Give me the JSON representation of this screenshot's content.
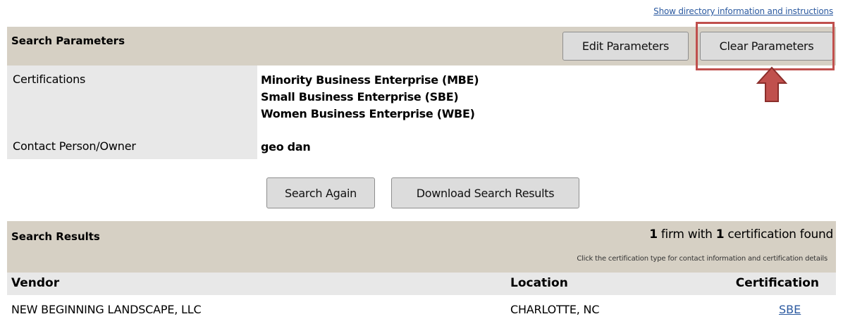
{
  "top_link": "Show directory information and instructions",
  "search_parameters": {
    "title": "Search Parameters",
    "edit_button": "Edit Parameters",
    "clear_button": "Clear Parameters",
    "rows": [
      {
        "label": "Certifications",
        "values": [
          "Minority Business Enterprise (MBE)",
          "Small Business Enterprise (SBE)",
          "Women Business Enterprise (WBE)"
        ]
      },
      {
        "label": "Contact Person/Owner",
        "values": [
          "geo dan"
        ]
      }
    ]
  },
  "actions": {
    "search_again": "Search Again",
    "download": "Download Search Results"
  },
  "search_results": {
    "title": "Search Results",
    "summary": {
      "firm_count": "1",
      "firm_text": " firm with ",
      "cert_count": "1",
      "cert_text": " certification found"
    },
    "note": "Click the certification type for contact information and certification details",
    "columns": {
      "vendor": "Vendor",
      "location": "Location",
      "certification": "Certification"
    },
    "rows": [
      {
        "vendor": "NEW BEGINNING LANDSCAPE, LLC",
        "location": "CHARLOTTE, NC",
        "certification": "SBE"
      }
    ]
  },
  "colors": {
    "band": "#d6d0c4",
    "label_cell": "#e8e8e8",
    "highlight": "#c0504d",
    "link": "#2c5aa0"
  }
}
